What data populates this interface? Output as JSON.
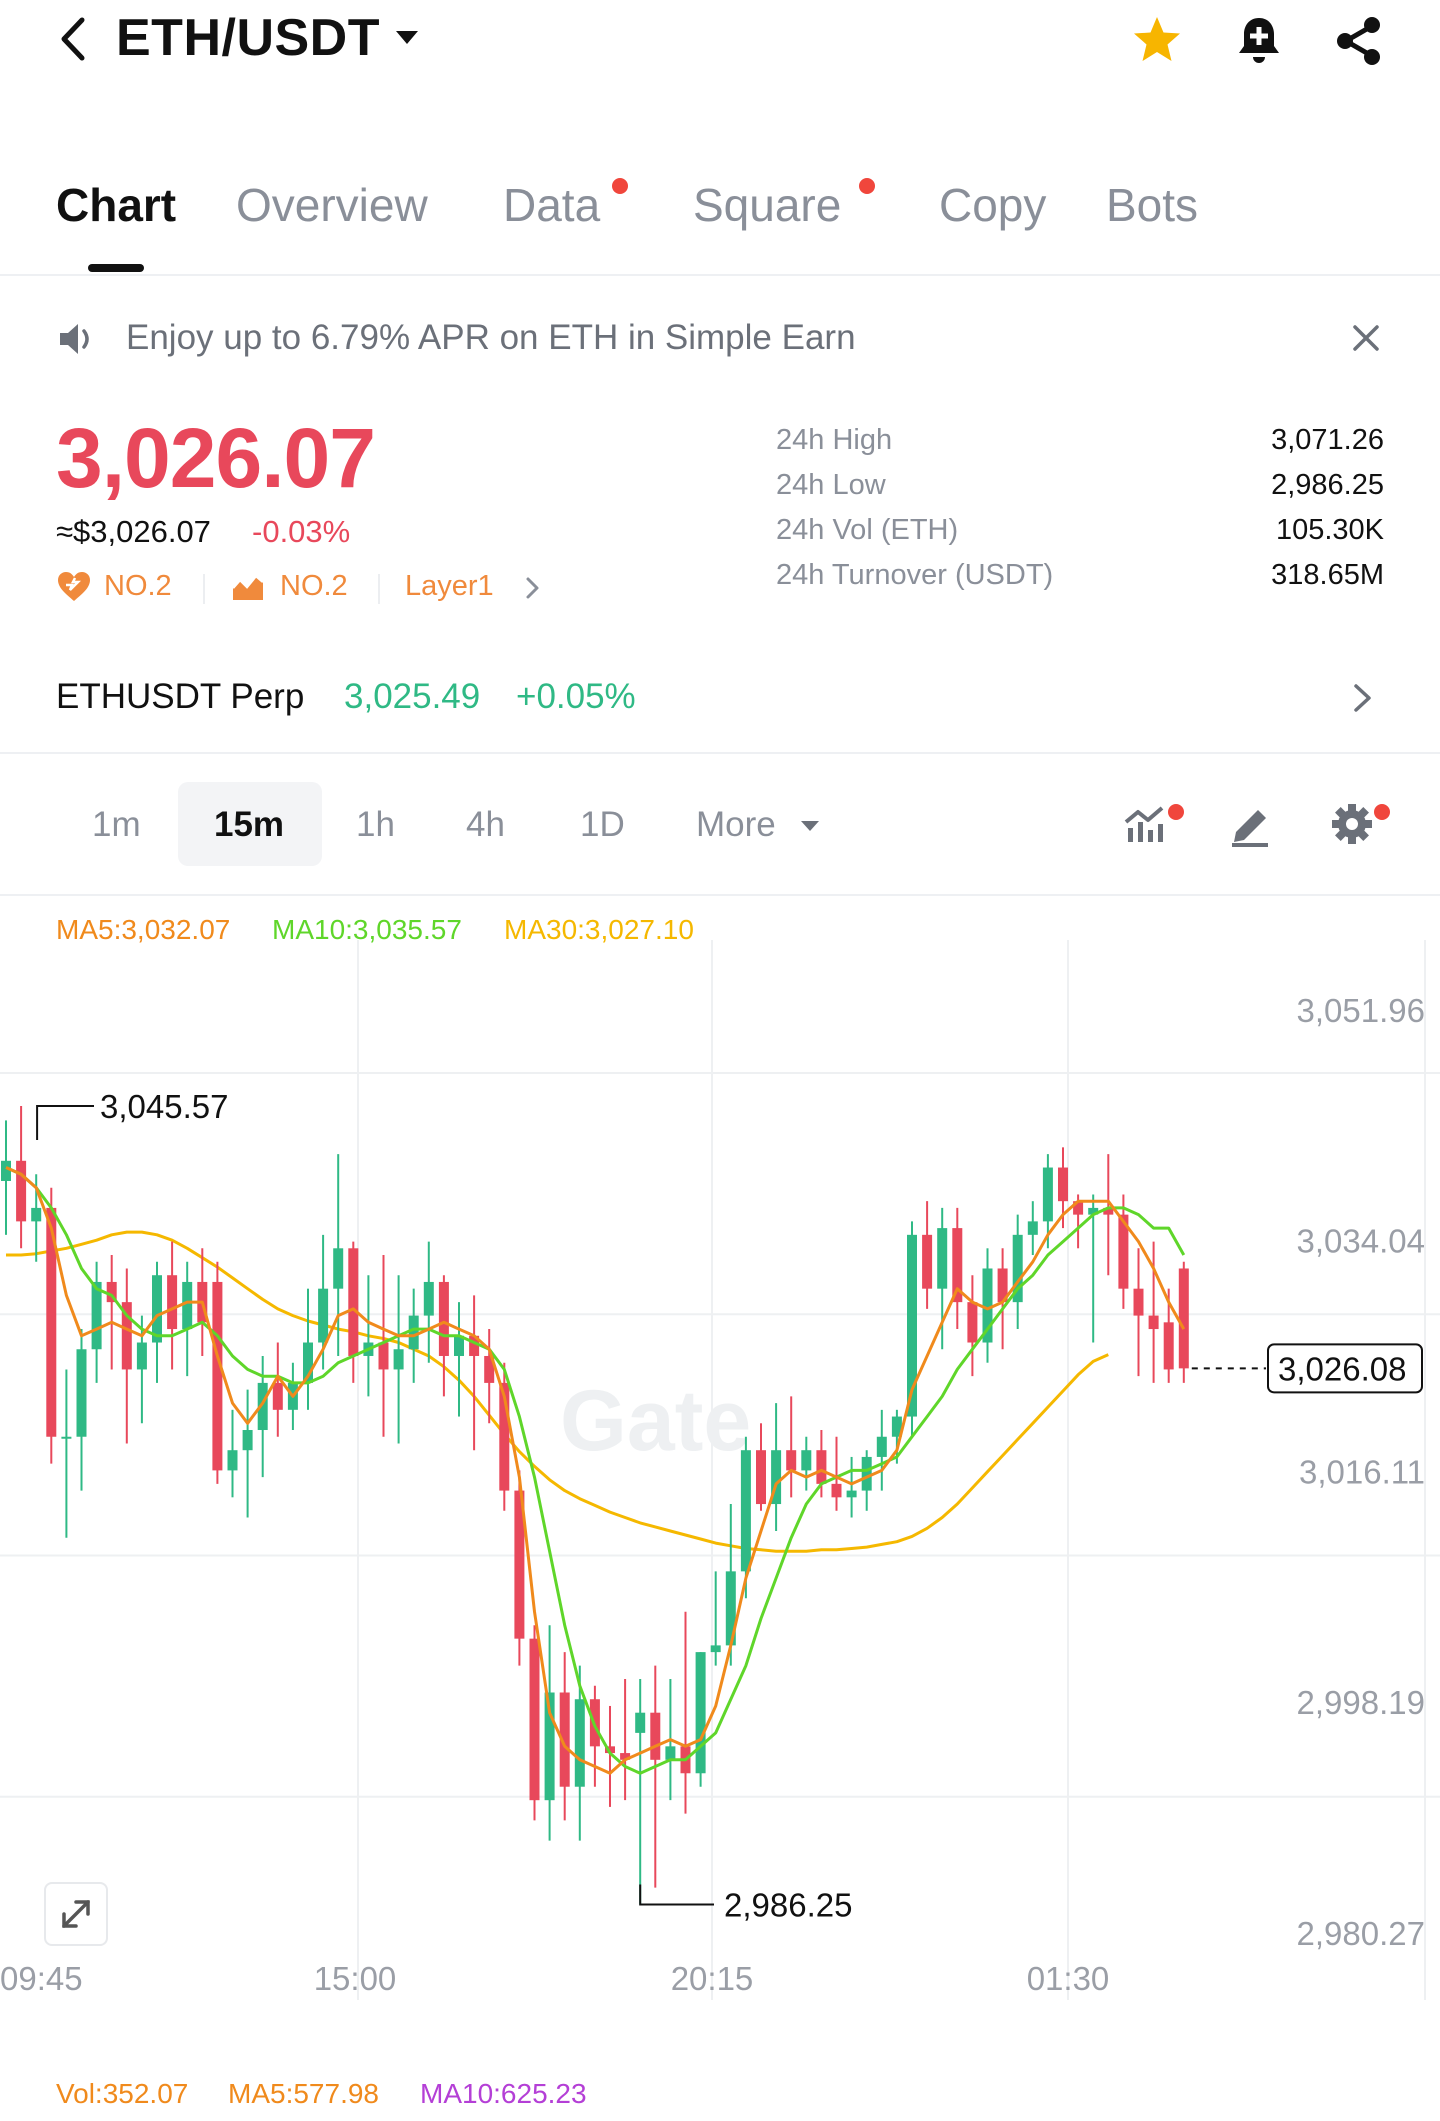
{
  "header": {
    "title": "ETH/USDT",
    "icons": [
      "back-icon",
      "caret-down-icon",
      "star-icon",
      "bell-add-icon",
      "share-icon"
    ],
    "star_color": "#f7b500"
  },
  "tabs": [
    {
      "label": "Chart",
      "active": true
    },
    {
      "label": "Overview",
      "active": false
    },
    {
      "label": "Data",
      "active": false,
      "dot": true
    },
    {
      "label": "Square",
      "active": false,
      "dot": true
    },
    {
      "label": "Copy",
      "active": false
    },
    {
      "label": "Bots",
      "active": false
    }
  ],
  "banner": {
    "text": "Enjoy up to 6.79% APR on ETH in Simple Earn"
  },
  "price": {
    "last": "3,026.07",
    "usd": "≈$3,026.07",
    "change": "-0.03%",
    "rank1": "NO.2",
    "rank2": "NO.2",
    "category": "Layer1"
  },
  "stats": [
    {
      "label": "24h High",
      "value": "3,071.26"
    },
    {
      "label": "24h Low",
      "value": "2,986.25"
    },
    {
      "label": "24h Vol (ETH)",
      "value": "105.30K"
    },
    {
      "label": "24h Turnover (USDT)",
      "value": "318.65M"
    }
  ],
  "perp": {
    "name": "ETHUSDT Perp",
    "price": "3,025.49",
    "change": "+0.05%"
  },
  "intervals": {
    "items": [
      "1m",
      "15m",
      "1h",
      "4h",
      "1D"
    ],
    "active": "15m",
    "more": "More"
  },
  "ma_legend": {
    "ma5": "MA5:3,032.07",
    "ma10": "MA10:3,035.57",
    "ma30": "MA30:3,027.10"
  },
  "colors": {
    "up": "#2fb985",
    "down": "#e8485b",
    "ma5": "#f08a1c",
    "ma10": "#5fd62a",
    "ma30": "#f5b800",
    "vol_ma10": "#b43fd6"
  },
  "chart_data": {
    "type": "candlestick",
    "x_tick_labels": [
      "09:45",
      "15:00",
      "20:15",
      "01:30"
    ],
    "y_tick_labels": [
      "3,051.96",
      "3,034.04",
      "3,016.11",
      "2,998.19",
      "2,980.27"
    ],
    "ylim": [
      2980.27,
      3051.96
    ],
    "high_marker": "3,045.57",
    "low_marker": "2,986.25",
    "last_price_label": "3,026.08",
    "watermark": "Gate",
    "candles": [
      {
        "o": 3040.0,
        "h": 3044.5,
        "l": 3036.0,
        "c": 3041.5
      },
      {
        "o": 3041.5,
        "h": 3045.57,
        "l": 3035.0,
        "c": 3037.0
      },
      {
        "o": 3037.0,
        "h": 3040.5,
        "l": 3034.0,
        "c": 3038.0
      },
      {
        "o": 3038.0,
        "h": 3039.5,
        "l": 3019.0,
        "c": 3021.0
      },
      {
        "o": 3021.0,
        "h": 3026.0,
        "l": 3013.5,
        "c": 3021.0
      },
      {
        "o": 3021.0,
        "h": 3029.0,
        "l": 3017.0,
        "c": 3027.5
      },
      {
        "o": 3027.5,
        "h": 3034.0,
        "l": 3025.0,
        "c": 3032.5
      },
      {
        "o": 3032.5,
        "h": 3034.5,
        "l": 3026.0,
        "c": 3031.0
      },
      {
        "o": 3031.0,
        "h": 3033.5,
        "l": 3020.5,
        "c": 3026.0
      },
      {
        "o": 3026.0,
        "h": 3030.0,
        "l": 3022.0,
        "c": 3028.0
      },
      {
        "o": 3028.0,
        "h": 3034.0,
        "l": 3025.0,
        "c": 3033.0
      },
      {
        "o": 3033.0,
        "h": 3035.5,
        "l": 3026.0,
        "c": 3029.0
      },
      {
        "o": 3029.0,
        "h": 3034.0,
        "l": 3025.5,
        "c": 3032.5
      },
      {
        "o": 3032.5,
        "h": 3035.0,
        "l": 3027.0,
        "c": 3029.5
      },
      {
        "o": 3032.5,
        "h": 3034.0,
        "l": 3017.5,
        "c": 3018.5
      },
      {
        "o": 3018.5,
        "h": 3023.0,
        "l": 3016.5,
        "c": 3020.0
      },
      {
        "o": 3020.0,
        "h": 3024.5,
        "l": 3015.0,
        "c": 3021.5
      },
      {
        "o": 3021.5,
        "h": 3027.0,
        "l": 3018.0,
        "c": 3025.0
      },
      {
        "o": 3025.0,
        "h": 3028.0,
        "l": 3021.0,
        "c": 3023.0
      },
      {
        "o": 3023.0,
        "h": 3026.5,
        "l": 3021.5,
        "c": 3025.0
      },
      {
        "o": 3025.0,
        "h": 3032.0,
        "l": 3023.0,
        "c": 3028.0
      },
      {
        "o": 3028.0,
        "h": 3036.0,
        "l": 3026.0,
        "c": 3032.0
      },
      {
        "o": 3032.0,
        "h": 3042.0,
        "l": 3027.0,
        "c": 3035.0
      },
      {
        "o": 3035.0,
        "h": 3035.5,
        "l": 3025.0,
        "c": 3027.0
      },
      {
        "o": 3027.0,
        "h": 3033.0,
        "l": 3024.0,
        "c": 3028.0
      },
      {
        "o": 3028.0,
        "h": 3034.5,
        "l": 3021.0,
        "c": 3026.0
      },
      {
        "o": 3026.0,
        "h": 3033.0,
        "l": 3020.5,
        "c": 3027.5
      },
      {
        "o": 3027.5,
        "h": 3032.0,
        "l": 3025.0,
        "c": 3030.0
      },
      {
        "o": 3030.0,
        "h": 3035.5,
        "l": 3026.5,
        "c": 3032.5
      },
      {
        "o": 3032.5,
        "h": 3033.0,
        "l": 3024.0,
        "c": 3027.0
      },
      {
        "o": 3027.0,
        "h": 3031.0,
        "l": 3022.5,
        "c": 3028.5
      },
      {
        "o": 3028.5,
        "h": 3031.5,
        "l": 3020.0,
        "c": 3027.0
      },
      {
        "o": 3027.0,
        "h": 3029.0,
        "l": 3022.0,
        "c": 3025.0
      },
      {
        "o": 3025.0,
        "h": 3026.5,
        "l": 3015.5,
        "c": 3017.0
      },
      {
        "o": 3017.0,
        "h": 3018.5,
        "l": 3004.0,
        "c": 3006.0
      },
      {
        "o": 3006.0,
        "h": 3007.0,
        "l": 2992.5,
        "c": 2994.0
      },
      {
        "o": 2994.0,
        "h": 3007.0,
        "l": 2991.0,
        "c": 3002.0
      },
      {
        "o": 3002.0,
        "h": 3005.0,
        "l": 2992.5,
        "c": 2995.0
      },
      {
        "o": 2995.0,
        "h": 3004.0,
        "l": 2991.0,
        "c": 3001.5
      },
      {
        "o": 3001.5,
        "h": 3002.5,
        "l": 2995.0,
        "c": 2998.0
      },
      {
        "o": 2998.0,
        "h": 3001.0,
        "l": 2993.5,
        "c": 2997.5
      },
      {
        "o": 2997.5,
        "h": 3003.0,
        "l": 2994.0,
        "c": 2997.0
      },
      {
        "o": 2999.0,
        "h": 3003.0,
        "l": 2986.25,
        "c": 3000.5
      },
      {
        "o": 3000.5,
        "h": 3004.0,
        "l": 2987.5,
        "c": 2997.0
      },
      {
        "o": 2997.0,
        "h": 3003.0,
        "l": 2994.0,
        "c": 2998.0
      },
      {
        "o": 2998.0,
        "h": 3008.0,
        "l": 2993.0,
        "c": 2996.0
      },
      {
        "o": 2996.0,
        "h": 3005.0,
        "l": 2995.0,
        "c": 3005.0
      },
      {
        "o": 3005.0,
        "h": 3011.0,
        "l": 3004.0,
        "c": 3005.5
      },
      {
        "o": 3005.5,
        "h": 3016.0,
        "l": 3004.0,
        "c": 3011.0
      },
      {
        "o": 3011.0,
        "h": 3021.0,
        "l": 3009.0,
        "c": 3020.0
      },
      {
        "o": 3020.0,
        "h": 3022.0,
        "l": 3015.5,
        "c": 3016.0
      },
      {
        "o": 3016.0,
        "h": 3023.5,
        "l": 3014.0,
        "c": 3020.0
      },
      {
        "o": 3020.0,
        "h": 3024.0,
        "l": 3016.5,
        "c": 3018.5
      },
      {
        "o": 3018.5,
        "h": 3021.0,
        "l": 3017.0,
        "c": 3020.0
      },
      {
        "o": 3020.0,
        "h": 3021.5,
        "l": 3016.5,
        "c": 3017.5
      },
      {
        "o": 3017.5,
        "h": 3021.0,
        "l": 3015.5,
        "c": 3016.5
      },
      {
        "o": 3016.5,
        "h": 3019.5,
        "l": 3015.0,
        "c": 3017.0
      },
      {
        "o": 3017.0,
        "h": 3020.0,
        "l": 3015.5,
        "c": 3019.5
      },
      {
        "o": 3019.5,
        "h": 3023.0,
        "l": 3017.0,
        "c": 3021.0
      },
      {
        "o": 3021.0,
        "h": 3023.0,
        "l": 3019.0,
        "c": 3022.5
      },
      {
        "o": 3022.5,
        "h": 3037.0,
        "l": 3021.0,
        "c": 3036.0
      },
      {
        "o": 3036.0,
        "h": 3038.5,
        "l": 3030.5,
        "c": 3032.0
      },
      {
        "o": 3032.0,
        "h": 3038.0,
        "l": 3027.5,
        "c": 3036.5
      },
      {
        "o": 3036.5,
        "h": 3038.0,
        "l": 3029.0,
        "c": 3031.0
      },
      {
        "o": 3031.0,
        "h": 3033.0,
        "l": 3025.5,
        "c": 3028.0
      },
      {
        "o": 3028.0,
        "h": 3035.0,
        "l": 3026.5,
        "c": 3033.5
      },
      {
        "o": 3033.5,
        "h": 3035.0,
        "l": 3027.5,
        "c": 3031.0
      },
      {
        "o": 3031.0,
        "h": 3037.5,
        "l": 3029.0,
        "c": 3036.0
      },
      {
        "o": 3036.0,
        "h": 3038.5,
        "l": 3034.5,
        "c": 3037.0
      },
      {
        "o": 3037.0,
        "h": 3042.0,
        "l": 3035.0,
        "c": 3041.0
      },
      {
        "o": 3041.0,
        "h": 3042.5,
        "l": 3036.5,
        "c": 3038.5
      },
      {
        "o": 3038.5,
        "h": 3039.0,
        "l": 3035.0,
        "c": 3037.5
      },
      {
        "o": 3037.5,
        "h": 3039.0,
        "l": 3028.0,
        "c": 3038.0
      },
      {
        "o": 3038.0,
        "h": 3042.0,
        "l": 3033.0,
        "c": 3037.5
      },
      {
        "o": 3037.5,
        "h": 3039.0,
        "l": 3030.5,
        "c": 3032.0
      },
      {
        "o": 3032.0,
        "h": 3035.0,
        "l": 3025.5,
        "c": 3030.0
      },
      {
        "o": 3030.0,
        "h": 3035.5,
        "l": 3025.0,
        "c": 3029.0
      },
      {
        "o": 3029.5,
        "h": 3032.0,
        "l": 3025.0,
        "c": 3026.0
      },
      {
        "o": 3033.5,
        "h": 3034.0,
        "l": 3025.0,
        "c": 3026.08
      }
    ],
    "ma5": [
      3041,
      3040.5,
      3039.5,
      3036.5,
      3031.5,
      3028.5,
      3029,
      3029.5,
      3029,
      3028.5,
      3030,
      3030.5,
      3031,
      3031,
      3027,
      3023.5,
      3022,
      3023.5,
      3025.5,
      3024,
      3025.5,
      3027.5,
      3030,
      3030.5,
      3029.5,
      3029,
      3028.5,
      3028.5,
      3029,
      3029.5,
      3029,
      3028.5,
      3027.5,
      3024,
      3018,
      3008,
      3000.5,
      2998,
      2997,
      2996.5,
      2996,
      2997,
      2997.5,
      2998,
      2998.5,
      2998,
      2998.5,
      3001,
      3005.5,
      3010.5,
      3014,
      3017.5,
      3018.5,
      3018,
      3018.5,
      3018,
      3017.5,
      3018,
      3018.5,
      3020,
      3024.5,
      3027,
      3029.5,
      3032,
      3031,
      3030.5,
      3031,
      3032.5,
      3034,
      3036,
      3037.5,
      3038.5,
      3038.5,
      3038.5,
      3037,
      3035.5,
      3033.5,
      3031,
      3029
    ],
    "ma10": [
      3041,
      3040.5,
      3039.5,
      3038,
      3036,
      3033.5,
      3032,
      3031.5,
      3030,
      3029,
      3028.5,
      3028.5,
      3029,
      3029.5,
      3028.5,
      3027,
      3026,
      3025.5,
      3025.5,
      3025,
      3025,
      3025.5,
      3026.5,
      3027,
      3027.5,
      3028,
      3028.5,
      3029,
      3029,
      3028.5,
      3028.5,
      3028,
      3027.5,
      3026,
      3022.5,
      3018,
      3012.5,
      3007,
      3002.5,
      2999.5,
      2997.5,
      2996.5,
      2996,
      2996.5,
      2997,
      2997,
      2998,
      2999,
      3001.5,
      3004,
      3007.5,
      3010.5,
      3013.5,
      3016,
      3017.5,
      3018,
      3018.5,
      3018.5,
      3019,
      3019.5,
      3021,
      3022.5,
      3024,
      3026,
      3027.5,
      3029,
      3030.5,
      3032,
      3033,
      3034.5,
      3035.5,
      3036.5,
      3037.5,
      3038,
      3038,
      3037.5,
      3036.5,
      3036.5,
      3034.5
    ],
    "ma30": [
      3034.5,
      3034.5,
      3034.6,
      3034.8,
      3035.0,
      3035.3,
      3035.6,
      3036.0,
      3036.2,
      3036.2,
      3036.0,
      3035.6,
      3035.0,
      3034.3,
      3033.6,
      3032.8,
      3032.0,
      3031.2,
      3030.5,
      3030.0,
      3029.6,
      3029.3,
      3029.0,
      3028.8,
      3028.5,
      3028.3,
      3028.0,
      3027.5,
      3027.0,
      3026.2,
      3025.2,
      3024.0,
      3022.6,
      3021.2,
      3019.9,
      3018.8,
      3017.8,
      3017.0,
      3016.4,
      3015.9,
      3015.4,
      3015.0,
      3014.6,
      3014.3,
      3014.0,
      3013.7,
      3013.4,
      3013.1,
      3012.9,
      3012.7,
      3012.6,
      3012.5,
      3012.5,
      3012.5,
      3012.6,
      3012.6,
      3012.7,
      3012.8,
      3013.0,
      3013.2,
      3013.6,
      3014.2,
      3015.0,
      3016.0,
      3017.2,
      3018.4,
      3019.6,
      3020.8,
      3022.0,
      3023.2,
      3024.4,
      3025.6,
      3026.6,
      3027.1
    ]
  },
  "volume_legend": {
    "vol": "Vol:352.07",
    "ma5": "MA5:577.98",
    "ma10": "MA10:625.23"
  }
}
